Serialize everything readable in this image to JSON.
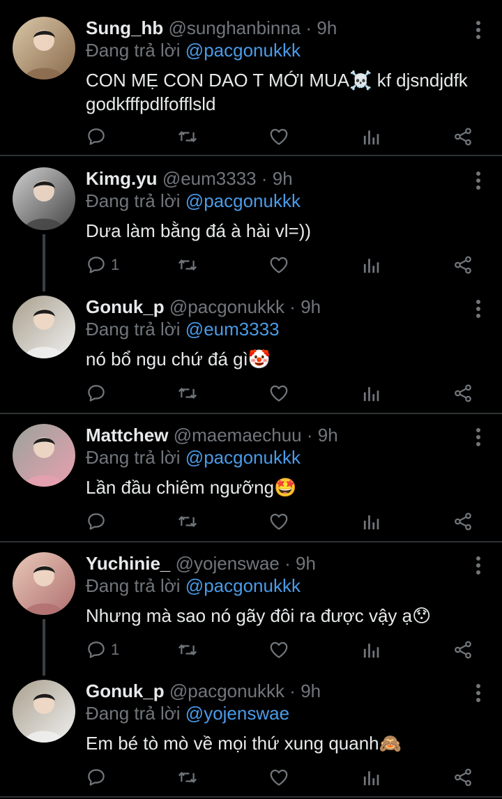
{
  "reply_prefix": "Đang trả lời",
  "tweets": [
    {
      "name": "Sung_hb",
      "handle": "@sunghanbinna",
      "separator": "·",
      "time": "9h",
      "reply_to": "@pacgonukkk",
      "text": "CON MẸ CON DAO T MỚI MUA☠️ kf djsndjdfkgodkfffpdlfofflsld",
      "reply_count": "",
      "avatar_colors": [
        "#d9c7a8",
        "#8a6a4c"
      ]
    },
    {
      "name": "Kimg.yu",
      "handle": "@eum3333",
      "separator": "·",
      "time": "9h",
      "reply_to": "@pacgonukkk",
      "text": "Dưa làm bằng đá à hài vl=))",
      "reply_count": "1",
      "avatar_colors": [
        "#cfcfcf",
        "#444444"
      ]
    },
    {
      "name": "Gonuk_p",
      "handle": "@pacgonukkk",
      "separator": "·",
      "time": "9h",
      "reply_to": "@eum3333",
      "text": "nó bổ ngu chứ đá gì🤡",
      "reply_count": "",
      "avatar_colors": [
        "#a9a08e",
        "#f0f0f0"
      ]
    },
    {
      "name": "Mattchew",
      "handle": "@maemaechuu",
      "separator": "·",
      "time": "9h",
      "reply_to": "@pacgonukkk",
      "text": "Lần đầu chiêm ngưỡng🤩",
      "reply_count": "",
      "avatar_colors": [
        "#9aa29a",
        "#e8a0b0"
      ]
    },
    {
      "name": "Yuchinie_",
      "handle": "@yojenswae",
      "separator": "·",
      "time": "9h",
      "reply_to": "@pacgonukkk",
      "text": "Nhưng mà sao nó gãy đôi ra được vậy ạ😯",
      "reply_count": "1",
      "avatar_colors": [
        "#e8c8b8",
        "#b07070"
      ]
    },
    {
      "name": "Gonuk_p",
      "handle": "@pacgonukkk",
      "separator": "·",
      "time": "9h",
      "reply_to": "@yojenswae",
      "text": "Em bé tò mò về mọi thứ xung quanh🙈",
      "reply_count": "",
      "avatar_colors": [
        "#a9a08e",
        "#f0f0f0"
      ]
    }
  ],
  "colors": {
    "background": "#000000",
    "text": "#e7e9ea",
    "muted": "#71767b",
    "mention": "#4a9be8",
    "divider": "#2f3336"
  },
  "icons": [
    "reply-icon",
    "retweet-icon",
    "like-icon",
    "analytics-icon",
    "share-icon",
    "more-icon"
  ]
}
